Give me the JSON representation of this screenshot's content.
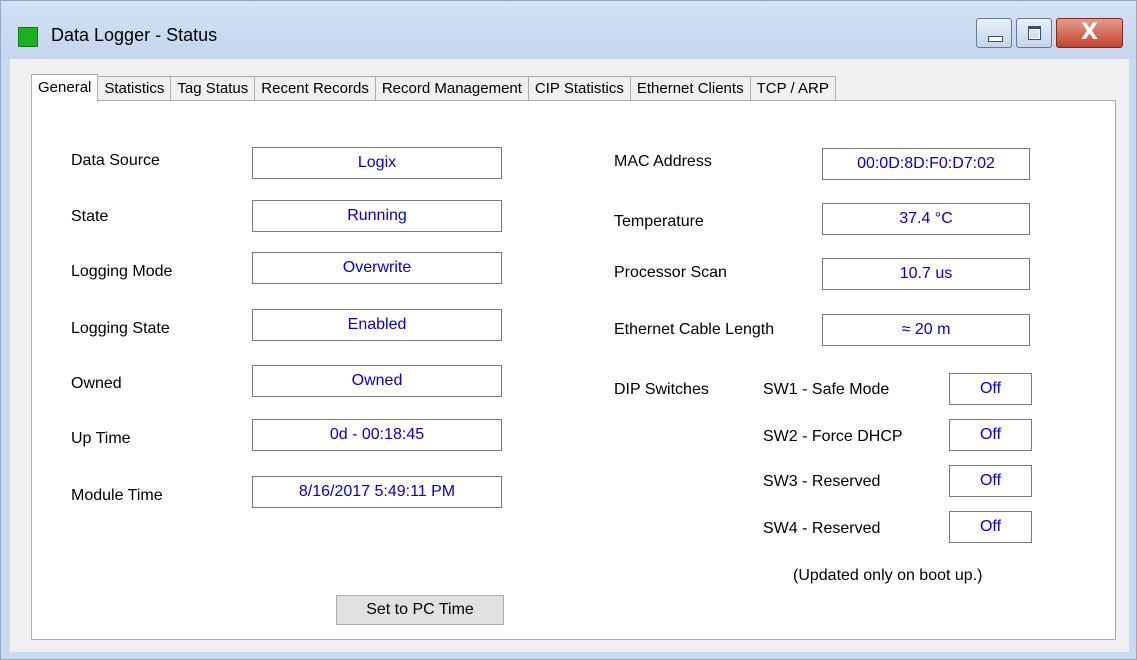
{
  "window": {
    "title": "Data Logger - Status",
    "close_glyph": "X"
  },
  "tabs": [
    {
      "label": "General"
    },
    {
      "label": "Statistics"
    },
    {
      "label": "Tag Status"
    },
    {
      "label": "Recent Records"
    },
    {
      "label": "Record Management"
    },
    {
      "label": "CIP Statistics"
    },
    {
      "label": "Ethernet Clients"
    },
    {
      "label": "TCP / ARP"
    }
  ],
  "general": {
    "data_source": {
      "label": "Data Source",
      "value": "Logix"
    },
    "state": {
      "label": "State",
      "value": "Running"
    },
    "logging_mode": {
      "label": "Logging Mode",
      "value": "Overwrite"
    },
    "logging_state": {
      "label": "Logging State",
      "value": "Enabled"
    },
    "owned": {
      "label": "Owned",
      "value": "Owned"
    },
    "up_time": {
      "label": "Up Time",
      "value": "0d - 00:18:45"
    },
    "module_time": {
      "label": "Module Time",
      "value": "8/16/2017 5:49:11 PM"
    },
    "set_time_button": "Set to PC Time",
    "mac_address": {
      "label": "MAC Address",
      "value": "00:0D:8D:F0:D7:02"
    },
    "temperature": {
      "label": "Temperature",
      "value": "37.4 °C"
    },
    "processor_scan": {
      "label": "Processor Scan",
      "value": "10.7 us"
    },
    "cable_length": {
      "label": "Ethernet Cable Length",
      "value": "≈ 20 m"
    },
    "dip": {
      "label": "DIP Switches",
      "switches": [
        {
          "label": "SW1 - Safe Mode",
          "value": "Off"
        },
        {
          "label": "SW2 - Force DHCP",
          "value": "Off"
        },
        {
          "label": "SW3 - Reserved",
          "value": "Off"
        },
        {
          "label": "SW4 - Reserved",
          "value": "Off"
        }
      ],
      "note": "(Updated only on boot up.)"
    }
  },
  "colors": {
    "value_text": "#0000e0",
    "status_icon": "#1bb11b",
    "close_button": "#c4432c"
  },
  "icons": {
    "app": "status-square-icon",
    "minimize": "minimize-icon",
    "maximize": "maximize-icon",
    "close": "close-icon"
  }
}
